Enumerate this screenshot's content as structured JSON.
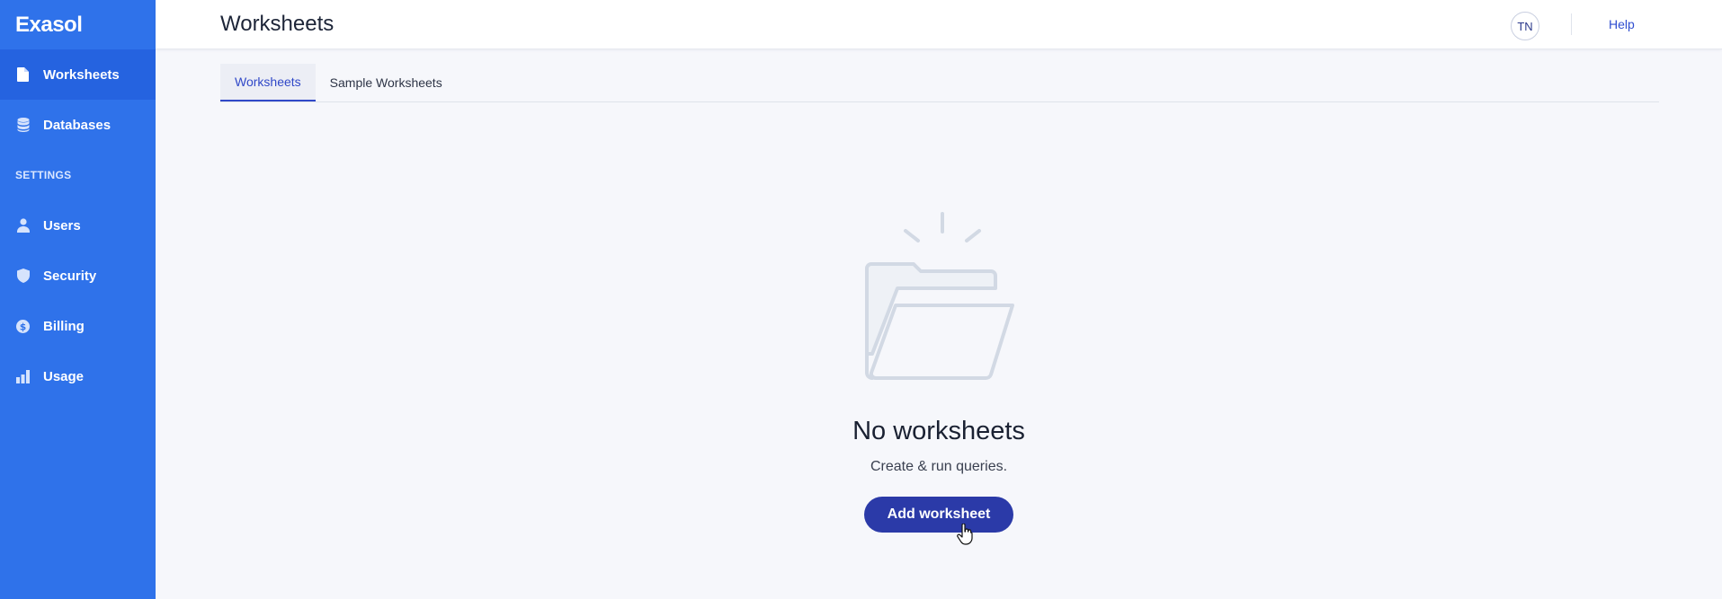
{
  "app": {
    "logo_text": "Exasol"
  },
  "sidebar": {
    "items": [
      {
        "label": "Worksheets",
        "icon": "document-icon",
        "active": true
      },
      {
        "label": "Databases",
        "icon": "database-icon",
        "active": false
      }
    ],
    "section_label": "SETTINGS",
    "settings_items": [
      {
        "label": "Users",
        "icon": "user-icon"
      },
      {
        "label": "Security",
        "icon": "shield-icon"
      },
      {
        "label": "Billing",
        "icon": "dollar-icon"
      },
      {
        "label": "Usage",
        "icon": "bar-chart-icon"
      }
    ]
  },
  "header": {
    "title": "Worksheets",
    "avatar_initials": "TN",
    "help_label": "Help"
  },
  "tabs": [
    {
      "label": "Worksheets",
      "active": true
    },
    {
      "label": "Sample Worksheets",
      "active": false
    }
  ],
  "empty_state": {
    "illustration": "open-folder-icon",
    "title": "No worksheets",
    "subtitle": "Create & run queries.",
    "button_label": "Add worksheet"
  },
  "colors": {
    "sidebar_bg": "#2f72ea",
    "sidebar_active_bg": "#2563e0",
    "primary_button": "#2b3aa8",
    "accent": "#3048c8"
  }
}
